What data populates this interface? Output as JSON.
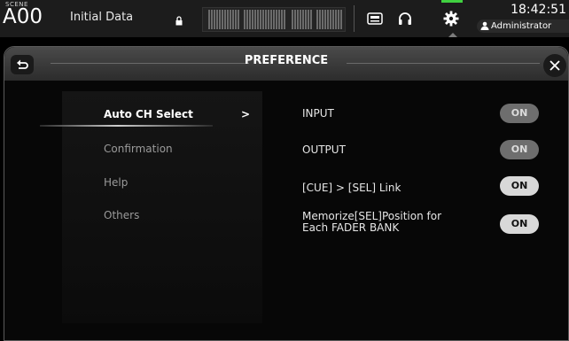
{
  "status_bar": {
    "scene_tag": "SCENE",
    "scene_number": "A00",
    "scene_name": "Initial Data",
    "time": "18:42:51",
    "user": "Administrator"
  },
  "window": {
    "title": "PREFERENCE",
    "menu": [
      {
        "label": "Auto CH Select",
        "arrow": ">",
        "active": true
      },
      {
        "label": "Confirmation",
        "active": false
      },
      {
        "label": "Help",
        "active": false
      },
      {
        "label": "Others",
        "active": false
      }
    ],
    "settings": [
      {
        "label": "INPUT",
        "value": "ON",
        "style": "dim"
      },
      {
        "label": "OUTPUT",
        "value": "ON",
        "style": "dim"
      },
      {
        "label": "[CUE] > [SEL] Link",
        "value": "ON",
        "style": "bright"
      },
      {
        "label_line1": "Memorize[SEL]Position for",
        "label_line2": "Each FADER BANK",
        "value": "ON",
        "style": "bright"
      }
    ]
  },
  "colors": {
    "active_indicator": "#40d040",
    "toggle_dim": "#6e6e6e",
    "toggle_bright": "#d8d8d8"
  },
  "icons": [
    "lock-icon",
    "meter-display",
    "recorder-icon",
    "headphones-icon",
    "gear-icon",
    "user-icon",
    "back-icon",
    "close-icon"
  ]
}
